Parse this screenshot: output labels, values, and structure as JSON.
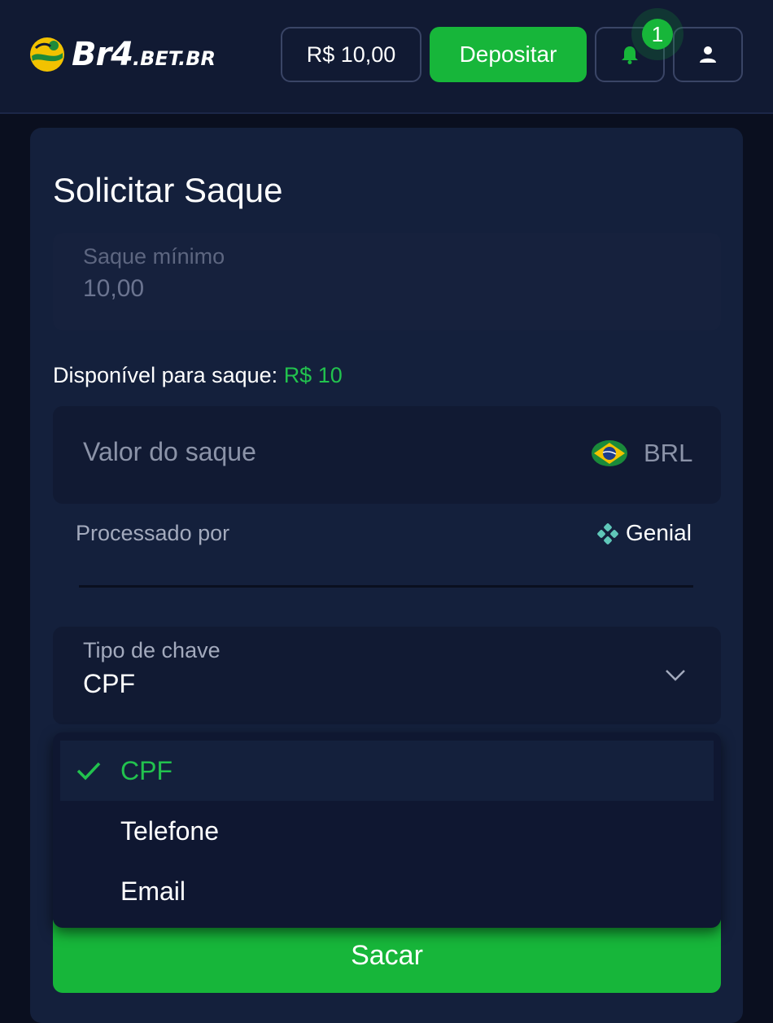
{
  "header": {
    "logo_text_main": "Br4",
    "logo_text_suffix": ".BET.BR",
    "balance": "R$ 10,00",
    "deposit_label": "Depositar",
    "notification_count": "1"
  },
  "withdraw": {
    "title": "Solicitar Saque",
    "min_label": "Saque mínimo",
    "min_value": "10,00",
    "available_label": "Disponível para saque:",
    "available_value": "R$ 10",
    "amount_placeholder": "Valor do saque",
    "currency": "BRL",
    "processed_label": "Processado por",
    "processor": "Genial",
    "key_type_label": "Tipo de chave",
    "key_type_value": "CPF",
    "submit_label": "Sacar"
  },
  "dropdown": {
    "options": [
      {
        "label": "CPF",
        "selected": true
      },
      {
        "label": "Telefone",
        "selected": false
      },
      {
        "label": "Email",
        "selected": false
      }
    ]
  },
  "colors": {
    "accent": "#17b63a",
    "background": "#0a0f1f",
    "card": "#14203c",
    "field": "#111a33"
  },
  "icons": [
    "logo-ball-icon",
    "bell-icon",
    "user-icon",
    "brazil-flag-icon",
    "genial-icon",
    "chevron-down-icon",
    "check-icon"
  ]
}
